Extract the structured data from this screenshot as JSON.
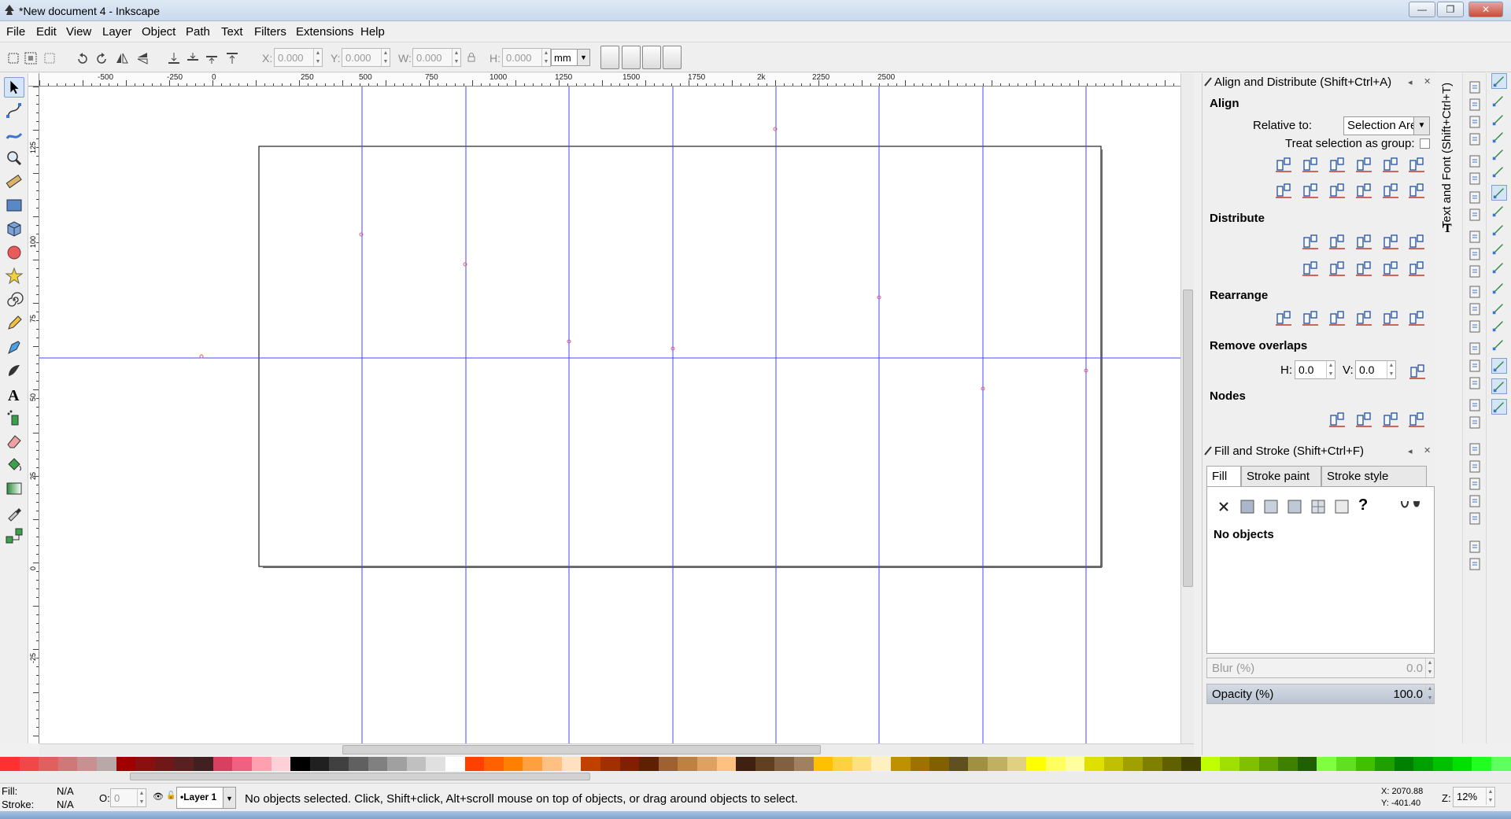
{
  "window": {
    "title": "*New document 4 - Inkscape",
    "minimize": "—",
    "maximize": "❐",
    "close": "✕"
  },
  "menu": [
    "File",
    "Edit",
    "View",
    "Layer",
    "Object",
    "Path",
    "Text",
    "Filters",
    "Extensions",
    "Help"
  ],
  "controls": {
    "x_label": "X:",
    "x_value": "0.000",
    "y_label": "Y:",
    "y_value": "0.000",
    "w_label": "W:",
    "w_value": "0.000",
    "h_label": "H:",
    "h_value": "0.000",
    "unit": "mm"
  },
  "ruler": {
    "h_ticks": [
      "-500",
      "-250",
      "0",
      "250",
      "500",
      "750",
      "1000",
      "1250",
      "1500",
      "1750",
      "2k",
      "2250",
      "2500"
    ],
    "v_ticks": [
      "125",
      "100",
      "75",
      "50",
      "25",
      "0",
      "-25"
    ]
  },
  "align_panel": {
    "title": "Align and Distribute (Shift+Ctrl+A)",
    "align_heading": "Align",
    "relative_label": "Relative to:",
    "relative_value": "Selection Area",
    "treat_group_label": "Treat selection as group:",
    "distribute_heading": "Distribute",
    "rearrange_heading": "Rearrange",
    "overlaps_heading": "Remove overlaps",
    "h_label": "H:",
    "h_value": "0.0",
    "v_label": "V:",
    "v_value": "0.0",
    "nodes_heading": "Nodes"
  },
  "fill_panel": {
    "title": "Fill and Stroke (Shift+Ctrl+F)",
    "tab_fill": "Fill",
    "tab_stroke_paint": "Stroke paint",
    "tab_stroke_style": "Stroke style",
    "no_objects": "No objects",
    "unknown": "?",
    "blur_label": "Blur (%)",
    "blur_value": "0.0",
    "opacity_label": "Opacity (%)",
    "opacity_value": "100.0"
  },
  "side_tab": "Text and Font (Shift+Ctrl+T)",
  "status": {
    "fill_label": "Fill:",
    "fill_value": "N/A",
    "stroke_label": "Stroke:",
    "stroke_value": "N/A",
    "opacity_label": "O:",
    "opacity_value": "0",
    "layer": "•Layer 1",
    "message": "No objects selected. Click, Shift+click, Alt+scroll mouse on top of objects, or drag around objects to select.",
    "coord_x": "X: 2070.88",
    "coord_y": "Y: -401.40",
    "zoom_label": "Z:",
    "zoom_value": "12%"
  },
  "colors": {
    "guide": "#3a3aff",
    "accent": "#7aa0d6"
  }
}
